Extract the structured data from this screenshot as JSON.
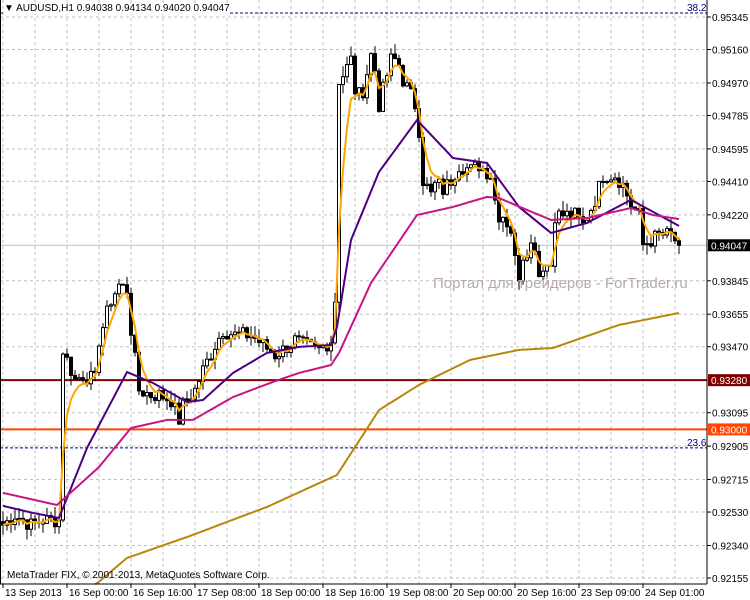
{
  "header": {
    "symbol": "AUDUSD,H1",
    "open": "0.94038",
    "high": "0.94134",
    "low": "0.94020",
    "close": "0.94047",
    "menu_icon": "triangle-down-icon"
  },
  "copyright": "MetaTrader FIX, © 2001-2013, MetaQuotes Software Corp.",
  "watermark": "Портал для трейдеров - ForTrader.ru",
  "colors": {
    "bg": "#ffffff",
    "grid": "#c0c0c0",
    "candle": "#000000",
    "ma_fast": "#ffa500",
    "ma_mid": "#4b0082",
    "ma_slow": "#c71585",
    "ma_long": "#b8860b",
    "level_dark": "#800000",
    "level_orange": "#ff4500",
    "fib": "#000080",
    "price_line": "#c0c0c0"
  },
  "chart_data": {
    "type": "candlestick",
    "title": "AUDUSD,H1",
    "ylim": [
      0.92155,
      0.95345
    ],
    "y_ticks": [
      "0.95345",
      "0.95160",
      "0.94970",
      "0.94785",
      "0.94595",
      "0.94410",
      "0.94220",
      "0.93845",
      "0.93655",
      "0.93470",
      "0.93095",
      "0.92905",
      "0.92715",
      "0.92530",
      "0.92340",
      "0.92155"
    ],
    "x_ticks": [
      {
        "bar": 0,
        "label": "13 Sep 2013"
      },
      {
        "bar": 16,
        "label": "16 Sep 00:00"
      },
      {
        "bar": 32,
        "label": "16 Sep 16:00"
      },
      {
        "bar": 48,
        "label": "17 Sep 08:00"
      },
      {
        "bar": 64,
        "label": "18 Sep 00:00"
      },
      {
        "bar": 80,
        "label": "18 Sep 16:00"
      },
      {
        "bar": 96,
        "label": "19 Sep 08:00"
      },
      {
        "bar": 112,
        "label": "20 Sep 00:00"
      },
      {
        "bar": 128,
        "label": "20 Sep 16:00"
      },
      {
        "bar": 144,
        "label": "23 Sep 09:00"
      },
      {
        "bar": 160,
        "label": "24 Sep 01:00"
      }
    ],
    "bars": 170,
    "close_path": [
      [
        0,
        0.92456
      ],
      [
        3,
        0.92513
      ],
      [
        7,
        0.92456
      ],
      [
        10,
        0.92485
      ],
      [
        14,
        0.92485
      ],
      [
        15,
        0.93452
      ],
      [
        17,
        0.93338
      ],
      [
        18,
        0.93281
      ],
      [
        20,
        0.93309
      ],
      [
        23,
        0.93281
      ],
      [
        24,
        0.93508
      ],
      [
        27,
        0.93736
      ],
      [
        29,
        0.93821
      ],
      [
        31,
        0.93793
      ],
      [
        32,
        0.93565
      ],
      [
        33,
        0.93395
      ],
      [
        34,
        0.93224
      ],
      [
        37,
        0.93196
      ],
      [
        39,
        0.93196
      ],
      [
        42,
        0.93167
      ],
      [
        44,
        0.93054
      ],
      [
        45,
        0.93139
      ],
      [
        48,
        0.93224
      ],
      [
        50,
        0.93338
      ],
      [
        53,
        0.9348
      ],
      [
        55,
        0.93565
      ],
      [
        58,
        0.93537
      ],
      [
        62,
        0.93537
      ],
      [
        65,
        0.9348
      ],
      [
        68,
        0.93423
      ],
      [
        70,
        0.93452
      ],
      [
        73,
        0.93508
      ],
      [
        75,
        0.9348
      ],
      [
        79,
        0.93452
      ],
      [
        82,
        0.93508
      ],
      [
        83,
        0.93736
      ],
      [
        84,
        0.94987
      ],
      [
        85,
        0.95015
      ],
      [
        87,
        0.95101
      ],
      [
        88,
        0.9493
      ],
      [
        89,
        0.94902
      ],
      [
        90,
        0.9493
      ],
      [
        92,
        0.95129
      ],
      [
        93,
        0.95044
      ],
      [
        94,
        0.94845
      ],
      [
        95,
        0.9493
      ],
      [
        97,
        0.95101
      ],
      [
        98,
        0.95101
      ],
      [
        99,
        0.95072
      ],
      [
        100,
        0.94987
      ],
      [
        102,
        0.94902
      ],
      [
        103,
        0.94845
      ],
      [
        104,
        0.94703
      ],
      [
        105,
        0.94418
      ],
      [
        107,
        0.94333
      ],
      [
        108,
        0.9439
      ],
      [
        109,
        0.9439
      ],
      [
        110,
        0.94361
      ],
      [
        112,
        0.94418
      ],
      [
        114,
        0.94503
      ],
      [
        117,
        0.94475
      ],
      [
        119,
        0.94503
      ],
      [
        122,
        0.94447
      ],
      [
        123,
        0.94305
      ],
      [
        124,
        0.94219
      ],
      [
        125,
        0.94219
      ],
      [
        127,
        0.94134
      ],
      [
        128,
        0.93963
      ],
      [
        129,
        0.93878
      ],
      [
        130,
        0.93992
      ],
      [
        132,
        0.94049
      ],
      [
        133,
        0.94049
      ],
      [
        134,
        0.93878
      ],
      [
        135,
        0.93935
      ],
      [
        137,
        0.93935
      ],
      [
        138,
        0.94219
      ],
      [
        140,
        0.94219
      ],
      [
        143,
        0.94219
      ],
      [
        145,
        0.94162
      ],
      [
        148,
        0.94305
      ],
      [
        150,
        0.94447
      ],
      [
        153,
        0.94447
      ],
      [
        155,
        0.9439
      ],
      [
        157,
        0.94276
      ],
      [
        159,
        0.94219
      ],
      [
        160,
        0.94049
      ],
      [
        162,
        0.94077
      ],
      [
        164,
        0.94105
      ],
      [
        167,
        0.94105
      ],
      [
        169,
        0.94047
      ]
    ],
    "series": [
      {
        "name": "MA fast",
        "color_key": "ma_fast",
        "computed": "ema",
        "period": 4
      },
      {
        "name": "MA mid",
        "color_key": "ma_mid",
        "points": [
          [
            0,
            0.92565
          ],
          [
            7.5,
            0.92525
          ],
          [
            14,
            0.92496
          ],
          [
            21,
            0.92894
          ],
          [
            31,
            0.93326
          ],
          [
            37.5,
            0.93264
          ],
          [
            46,
            0.93156
          ],
          [
            50,
            0.93167
          ],
          [
            57.5,
            0.93321
          ],
          [
            66,
            0.93435
          ],
          [
            74,
            0.93469
          ],
          [
            82,
            0.9348
          ],
          [
            83.5,
            0.93582
          ],
          [
            87,
            0.94077
          ],
          [
            94,
            0.94464
          ],
          [
            103.5,
            0.94759
          ],
          [
            112.5,
            0.94543
          ],
          [
            121,
            0.94515
          ],
          [
            129,
            0.94265
          ],
          [
            137,
            0.94117
          ],
          [
            146,
            0.94174
          ],
          [
            157,
            0.94305
          ],
          [
            169,
            0.94157
          ]
        ]
      },
      {
        "name": "MA slow",
        "color_key": "ma_slow",
        "points": [
          [
            0,
            0.92639
          ],
          [
            13.5,
            0.9257
          ],
          [
            24,
            0.92786
          ],
          [
            32,
            0.93008
          ],
          [
            41,
            0.93054
          ],
          [
            47.5,
            0.93054
          ],
          [
            57.5,
            0.93184
          ],
          [
            67.5,
            0.9327
          ],
          [
            74,
            0.93321
          ],
          [
            82,
            0.93366
          ],
          [
            84,
            0.93435
          ],
          [
            92,
            0.93833
          ],
          [
            103.5,
            0.94219
          ],
          [
            112.5,
            0.94265
          ],
          [
            121,
            0.94322
          ],
          [
            124,
            0.94316
          ],
          [
            131,
            0.94248
          ],
          [
            137,
            0.94191
          ],
          [
            146,
            0.94202
          ],
          [
            157,
            0.94259
          ],
          [
            162.5,
            0.94219
          ],
          [
            169,
            0.94196
          ]
        ]
      },
      {
        "name": "MA long",
        "color_key": "ma_long",
        "points": [
          [
            23,
            0.92115
          ],
          [
            31,
            0.92269
          ],
          [
            46,
            0.92388
          ],
          [
            66,
            0.92559
          ],
          [
            83.5,
            0.92741
          ],
          [
            94,
            0.9311
          ],
          [
            104,
            0.93253
          ],
          [
            116.75,
            0.93395
          ],
          [
            129,
            0.93452
          ],
          [
            137.5,
            0.93463
          ],
          [
            154,
            0.93594
          ],
          [
            169,
            0.93662
          ]
        ]
      }
    ],
    "levels": [
      {
        "name": "fib-38-2",
        "price": 0.95368,
        "label": "38.2",
        "style": "dashed",
        "color_key": "fib"
      },
      {
        "name": "fib-23-6",
        "price": 0.92895,
        "label": "23.6",
        "style": "dashed",
        "color_key": "fib"
      },
      {
        "name": "level-93280",
        "price": 0.9328,
        "label": "0.93280",
        "style": "solid",
        "color_key": "level_dark"
      },
      {
        "name": "level-93000",
        "price": 0.93,
        "label": "0.93000",
        "style": "solid",
        "color_key": "level_orange"
      },
      {
        "name": "current-price",
        "price": 0.94047,
        "label": "0.94047",
        "style": "solid",
        "color_key": "price_line"
      }
    ]
  }
}
